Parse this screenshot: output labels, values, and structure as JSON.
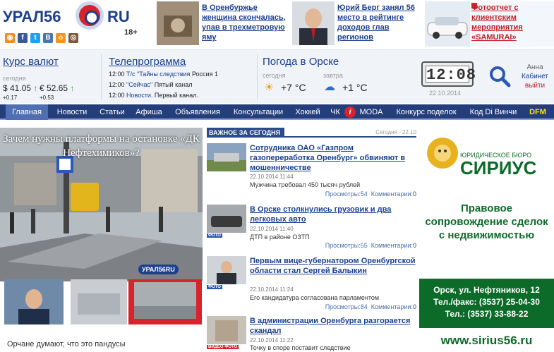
{
  "brand": {
    "logo_left": "УРАЛ56",
    "logo_right": "RU",
    "age_rating": "18+"
  },
  "social": [
    "rss",
    "facebook",
    "twitter",
    "vkontakte",
    "odnoklassniki",
    "instagram"
  ],
  "top_news": [
    {
      "title": "В Оренбуржье женщина скончалась, упав в трехметровую яму"
    },
    {
      "title": "Юрий Берг занял 56 место в рейтинге доходов глав регионов"
    },
    {
      "title": "Фотоотчет с клиентским мероприятия «SAMURAI»"
    }
  ],
  "currency": {
    "title": "Курс валют",
    "label": "сегодня",
    "usd": "$ 41.05",
    "usd_change": "+0.17",
    "eur": "€ 52.65",
    "eur_change": "+0.53"
  },
  "tv": {
    "title": "Телепрограмма",
    "items": [
      {
        "time": "12:00",
        "show": "Т/с \"Тайны следствия",
        "channel": "Россия 1"
      },
      {
        "time": "12:00",
        "show": "\"Сейчас\"",
        "channel": "Пятый канал"
      },
      {
        "time": "12:00",
        "show": "Новости.",
        "channel": "Первый канал."
      }
    ]
  },
  "weather": {
    "title_link": "Погода",
    "title_prep": "в",
    "title_city": "Орске",
    "today_label": "сегодня",
    "today_temp": "+7 °C",
    "tomorrow_label": "завтра",
    "tomorrow_temp": "+1 °C"
  },
  "clock": {
    "time": "12:08",
    "date": "22.10.2014"
  },
  "user": {
    "name": "Анна",
    "cabinet": "Кабинет",
    "logout": "выйти"
  },
  "nav": [
    "Главная",
    "Новости",
    "Статьи",
    "Афиша",
    "Объявления",
    "Консультации",
    "Хоккей",
    "ЧК",
    "MODA",
    "Конкурс поделок",
    "Код Di Винчи",
    "DFM"
  ],
  "feature": {
    "title": "Зачем нужны платформы на остановке «ДК Нефтехимиков»?",
    "watermark": "УРАЛ56RU",
    "caption": "Орчане думают, что это пандусы"
  },
  "section": {
    "title": "ВАЖНОЕ ЗА СЕГОДНЯ",
    "date": "Сегодня - 22.10"
  },
  "news": [
    {
      "title": "Сотрудника ОАО «Газпром газопереработка Оренбург» обвиняют в мошенничестве",
      "date": "22.10.2014 11:44",
      "summary": "Мужчина требовал 450 тысяч рублей",
      "views": "Просмотры:54",
      "comments_label": "Комментарии:",
      "comments": "0",
      "badge": ""
    },
    {
      "title": "В Орске столкнулись грузовик и два легковых авто",
      "date": "22.10.2014 11:40",
      "summary": "ДТП в районе ОЗТП",
      "views": "Просмотры:55",
      "comments_label": "Комментарии:",
      "comments": "0",
      "badge": "ФОТО"
    },
    {
      "title": "Первым вице-губернатором Оренбургской области стал Сергей Балыкин",
      "date": "22.10.2014 11:24",
      "summary": "Его кандидатура согласована парламентом",
      "views": "Просмотры:84",
      "comments_label": "Комментарии:",
      "comments": "0",
      "badge": "ФОТО"
    },
    {
      "title": "В администрации Оренбурга разгорается скандал",
      "date": "22.10.2014 11:22",
      "summary": "Точку в споре поставит следствие",
      "views": "",
      "comments_label": "",
      "comments": "",
      "badge": "ВИДЕО ФОТО"
    }
  ],
  "ad": {
    "brand_top": "ЮРИДИЧЕСКОЕ БЮРО",
    "brand_name": "СИРИУС",
    "slogan": "Правовое сопровождение сделок с недвижимостью",
    "address": "Орск, ул. Нефтяников, 12",
    "phone1": "Тел./факс: (3537) 25-04-30",
    "phone2": "Тел.: (3537) 33-88-22",
    "site": "www.sirius56.ru"
  },
  "colors": {
    "nav_bg": "#243e7c",
    "link": "#1a3f8f",
    "accent_red": "#d8232a",
    "ad_green": "#0d6b2a",
    "dfm_yellow": "#ffe600"
  }
}
